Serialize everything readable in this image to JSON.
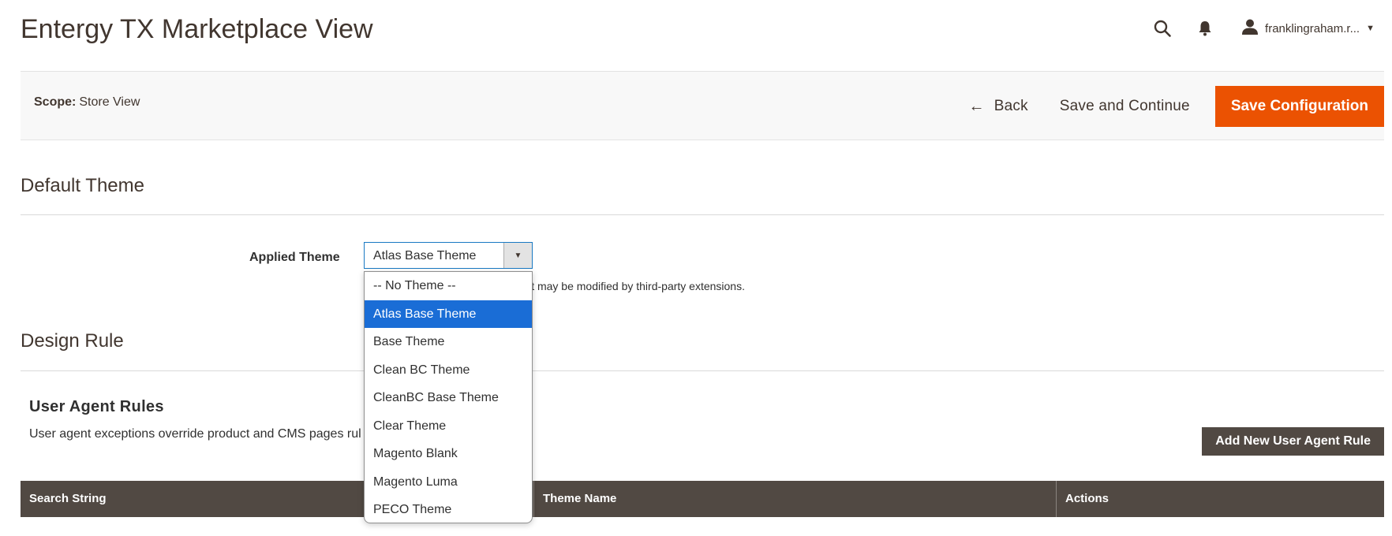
{
  "header": {
    "title": "Entergy TX Marketplace View",
    "user_name": "franklingraham.r..."
  },
  "icons": {
    "search": "search-icon",
    "notifications": "bell-icon",
    "user": "user-icon",
    "back": "arrow-left-icon",
    "dropdown": "triangle-down-icon"
  },
  "action_bar": {
    "scope_label": "Scope:",
    "scope_value": "Store View",
    "back_label": "Back",
    "save_continue_label": "Save and Continue",
    "save_config_label": "Save Configuration"
  },
  "default_theme": {
    "title": "Default Theme",
    "applied_theme_label": "Applied Theme",
    "selected_value": "Atlas Base Theme",
    "note_visible": "default is used. The system default may be modified by third-party extensions.",
    "options": [
      "-- No Theme --",
      "Atlas Base Theme",
      "Base Theme",
      "Clean BC Theme",
      "CleanBC Base Theme",
      "Clear Theme",
      "Magento Blank",
      "Magento Luma",
      "PECO Theme"
    ],
    "highlighted_index": 1
  },
  "design_rule": {
    "title": "Design Rule",
    "user_agent_title": "User Agent Rules",
    "user_agent_desc": "User agent exceptions override product and CMS pages rul",
    "add_rule_label": "Add New User Agent Rule",
    "table_headers": [
      "Search String",
      "Theme Name",
      "Actions"
    ]
  },
  "colors": {
    "primary_orange": "#eb5202",
    "dark_brown": "#514943",
    "selected_blue": "#1a6dd6",
    "focus_blue": "#1979c3"
  }
}
